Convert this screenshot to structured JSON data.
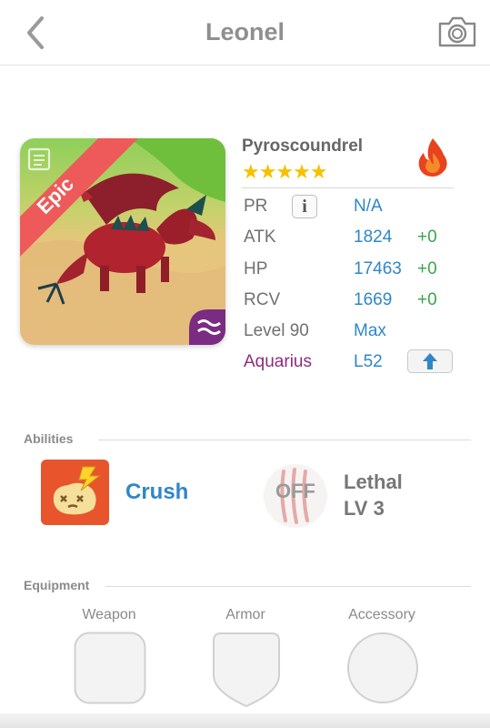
{
  "header": {
    "title": "Leonel",
    "back_icon": "chevron-left-icon",
    "camera_icon": "camera-icon"
  },
  "monster": {
    "rarity": "Epic",
    "name": "Pyroscoundrel",
    "stars": "★★★★★",
    "star_count": 5,
    "element_icon": "fire-icon",
    "element_color": "#e8431e",
    "stats": {
      "pr": {
        "label": "PR",
        "value": "N/A"
      },
      "atk": {
        "label": "ATK",
        "value": "1824",
        "bonus": "+0"
      },
      "hp": {
        "label": "HP",
        "value": "17463",
        "bonus": "+0"
      },
      "rcv": {
        "label": "RCV",
        "value": "1669",
        "bonus": "+0"
      },
      "level": {
        "label": "Level 90",
        "value": "Max"
      },
      "constellation": {
        "label": "Aquarius",
        "value": "L52"
      }
    }
  },
  "abilities": {
    "section_label": "Abilities",
    "active": {
      "name": "Crush",
      "icon": "crush-icon"
    },
    "passive": {
      "state": "OFF",
      "name": "Lethal",
      "level": "LV 3",
      "icon": "claw-marks-icon"
    }
  },
  "equipment": {
    "section_label": "Equipment",
    "slots": [
      {
        "label": "Weapon"
      },
      {
        "label": "Armor"
      },
      {
        "label": "Accessory"
      }
    ]
  },
  "colors": {
    "accent_blue": "#2f87c8",
    "bonus_green": "#3aa64a",
    "constellation_purple": "#8b2d7e",
    "star_gold": "#f5c100",
    "epic_ribbon": "#ee5a5a"
  }
}
